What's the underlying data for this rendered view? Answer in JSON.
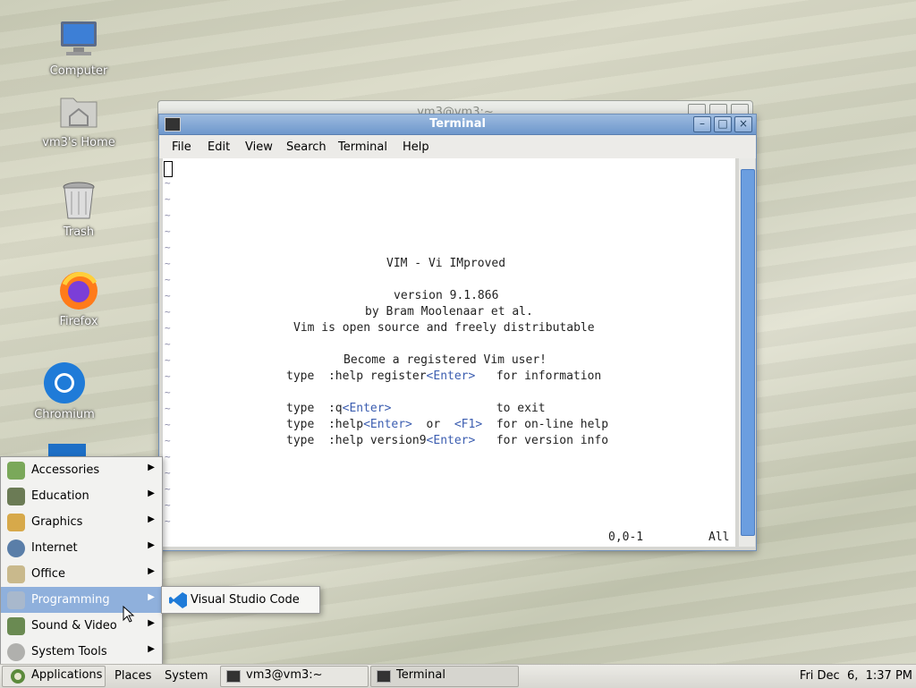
{
  "desktop": {
    "icons": [
      {
        "label": "Computer"
      },
      {
        "label": "vm3's Home"
      },
      {
        "label": "Trash"
      },
      {
        "label": "Firefox"
      },
      {
        "label": "Chromium"
      }
    ]
  },
  "back_window": {
    "title": "vm3@vm3:~"
  },
  "terminal": {
    "title": "Terminal",
    "menu": [
      "File",
      "Edit",
      "View",
      "Search",
      "Terminal",
      "Help"
    ],
    "vim": {
      "title": "VIM - Vi IMproved",
      "version": "version 9.1.866",
      "author": "by Bram Moolenaar et al.",
      "license": "Vim is open source and freely distributable",
      "register": "Become a registered Vim user!",
      "lines": [
        {
          "pre": "type  :help register",
          "key": "<Enter>",
          "mid": "",
          "key2": "",
          "post": "   for information"
        },
        {
          "pre": "type  :q",
          "key": "<Enter>",
          "mid": "",
          "key2": "",
          "post": "               to exit"
        },
        {
          "pre": "type  :help",
          "key": "<Enter>",
          "mid": "  or  ",
          "key2": "<F1>",
          "post": "  for on-line help"
        },
        {
          "pre": "type  :help version9",
          "key": "<Enter>",
          "mid": "",
          "key2": "",
          "post": "   for version info"
        }
      ],
      "ruler": "0,0-1",
      "scroll_pos": "All"
    }
  },
  "app_menu": {
    "items": [
      {
        "label": "Accessories"
      },
      {
        "label": "Education"
      },
      {
        "label": "Graphics"
      },
      {
        "label": "Internet"
      },
      {
        "label": "Office"
      },
      {
        "label": "Programming"
      },
      {
        "label": "Sound & Video"
      },
      {
        "label": "System Tools"
      }
    ],
    "submenu": {
      "label": "Visual Studio Code"
    }
  },
  "taskbar": {
    "applications": "Applications",
    "places": "Places",
    "system": "System",
    "tasks": [
      {
        "label": "vm3@vm3:~"
      },
      {
        "label": "Terminal"
      }
    ],
    "clock": "Fri Dec  6,  1:37 PM"
  },
  "colors": {
    "titlebar": "#7aa0d2",
    "menu_selected": "#8fb0dc",
    "vim_key": "#3b5db0"
  }
}
